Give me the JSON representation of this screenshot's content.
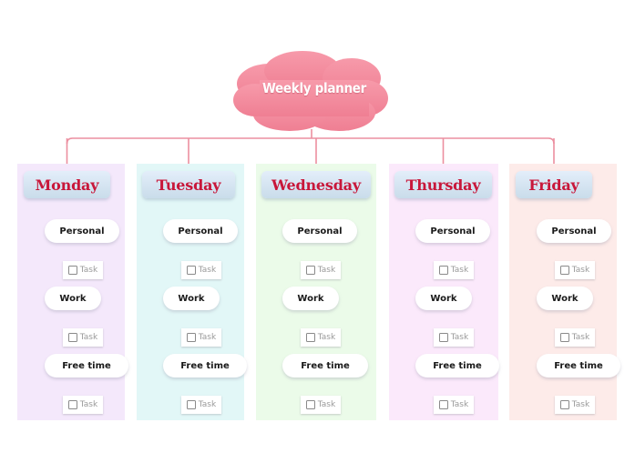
{
  "title": "Weekly planner",
  "colors": {
    "cloud": "#f28497",
    "connector": "#ec8fa0",
    "day_text": "#c8173a"
  },
  "days": [
    {
      "label": "Monday",
      "bg": "#f4e8fb"
    },
    {
      "label": "Tuesday",
      "bg": "#e2f7f7"
    },
    {
      "label": "Wednesday",
      "bg": "#ebfbe9"
    },
    {
      "label": "Thursday",
      "bg": "#fbe9fb"
    },
    {
      "label": "Friday",
      "bg": "#fdebe9"
    }
  ],
  "categories": [
    {
      "label": "Personal",
      "task": {
        "label": "Task",
        "checked": false
      }
    },
    {
      "label": "Work",
      "task": {
        "label": "Task",
        "checked": false
      }
    },
    {
      "label": "Free time",
      "task": {
        "label": "Task",
        "checked": false
      }
    }
  ]
}
